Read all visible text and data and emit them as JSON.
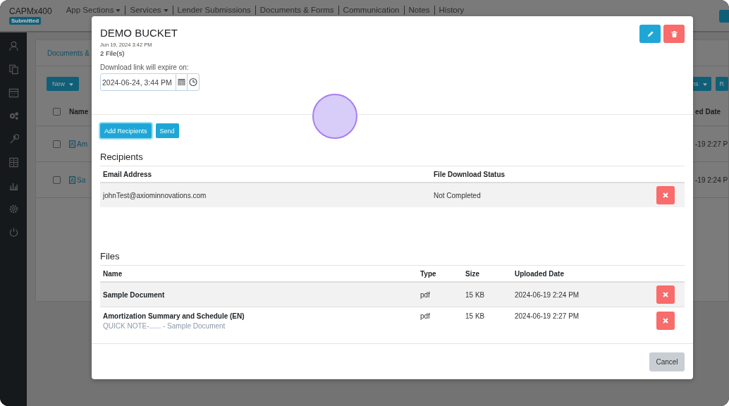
{
  "app": {
    "brand": "CAPMx400",
    "status_badge": "Submitted",
    "nav": [
      {
        "label": "App Sections",
        "dropdown": true
      },
      {
        "label": "Services",
        "dropdown": true
      },
      {
        "label": "Lender Submissions",
        "dropdown": false
      },
      {
        "label": "Documents & Forms",
        "dropdown": false
      },
      {
        "label": "Communication",
        "dropdown": false
      },
      {
        "label": "Notes",
        "dropdown": false
      },
      {
        "label": "History",
        "dropdown": false
      }
    ]
  },
  "background": {
    "panel_tab": "Documents &",
    "new_button": "New",
    "name_header": "Name",
    "date_header": "ed Date",
    "actions_button": "ns",
    "remove_button": "R",
    "all_checked": false,
    "rows": [
      {
        "name": "Am",
        "date": "-19 2:27 P",
        "checked": false
      },
      {
        "name": "Sa",
        "date": "-19 2:24 P",
        "checked": false
      }
    ]
  },
  "modal": {
    "title": "DEMO BUCKET",
    "created": "Jun 19, 2024 3:42 PM",
    "file_count": "2 File(s)",
    "expiry_label": "Download link will expire on:",
    "expiry_value": "2024-06-24, 3:44 PM",
    "actions": [
      {
        "label": "Add Recipients",
        "focused": true
      },
      {
        "label": "Send",
        "focused": false
      }
    ],
    "recipients": {
      "title": "Recipients",
      "columns": [
        "Email Address",
        "File Download Status"
      ],
      "rows": [
        {
          "email": "johnTest@axiominnovations.com",
          "status": "Not Completed",
          "highlighted": true
        }
      ]
    },
    "files": {
      "title": "Files",
      "columns": [
        "Name",
        "Type",
        "Size",
        "Uploaded Date"
      ],
      "rows": [
        {
          "name": "Sample Document",
          "type": "pdf",
          "size": "15 KB",
          "date": "2024-06-19 2:24 PM",
          "highlighted": true
        },
        {
          "name": "Amortization Summary and Schedule (EN)",
          "note": "QUICK NOTE-...... - Sample Document",
          "type": "pdf",
          "size": "15 KB",
          "date": "2024-06-19 2:27 PM",
          "highlighted": false
        }
      ]
    },
    "cancel_button": "Cancel"
  }
}
